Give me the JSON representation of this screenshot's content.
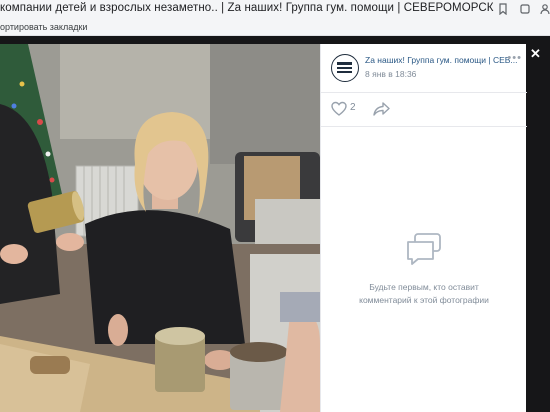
{
  "browser": {
    "tab_title": "компании детей и взрослых незаметно.. | Za наших! Группа гум. помощи | СЕВЕРОМОРСК",
    "bookmarks_label": "ортировать закладки"
  },
  "post": {
    "group_name": "Za наших! Группа гум. помощи | СЕВ...",
    "date": "8 янв в 18:36",
    "likes": "2"
  },
  "comments": {
    "empty_line1": "Будьте первым, кто оставит",
    "empty_line2": "комментарий к этой фотографии"
  },
  "icons": {
    "like": "heart-outline-icon",
    "share": "share-arrow-icon",
    "comment": "comment-bubble-icon",
    "more": "more-dots-icon",
    "close": "close-icon"
  },
  "colors": {
    "link": "#2a5885",
    "muted": "#818c99",
    "icon": "#99a2ad"
  }
}
